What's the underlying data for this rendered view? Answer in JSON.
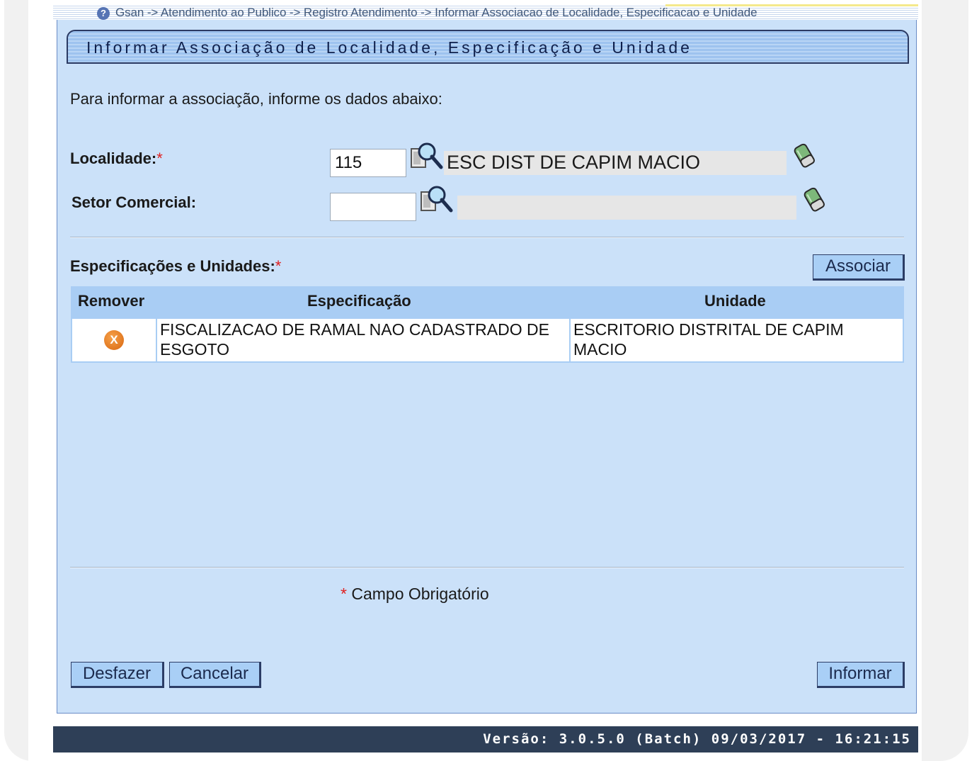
{
  "breadcrumb": {
    "help_icon": "?",
    "text": "Gsan -> Atendimento ao Publico -> Registro Atendimento -> Informar Associacao de Localidade, Especificacao e Unidade"
  },
  "page": {
    "title": "Informar Associação de Localidade, Especificação e Unidade",
    "intro": "Para informar a associação, informe os dados abaixo:"
  },
  "form": {
    "localidade": {
      "label": "Localidade:",
      "required_mark": "*",
      "code": "115",
      "description": "ESC DIST DE CAPIM MACIO",
      "search_icon": "magnifier-search-icon",
      "clear_icon": "eraser-icon"
    },
    "setor_comercial": {
      "label": "Setor Comercial:",
      "code": "",
      "description": "",
      "search_icon": "magnifier-search-icon",
      "clear_icon": "eraser-icon"
    },
    "especificacoes": {
      "label": "Especificações e Unidades:",
      "required_mark": "*",
      "associate_button": "Associar",
      "columns": [
        "Remover",
        "Especificação",
        "Unidade"
      ],
      "rows": [
        {
          "remove_icon": "X",
          "especificacao": "FISCALIZACAO DE RAMAL NAO CADASTRADO DE ESGOTO",
          "unidade": "ESCRITORIO DISTRITAL DE CAPIM MACIO"
        }
      ]
    }
  },
  "footer": {
    "required_mark": "*",
    "required_note": "Campo Obrigatório",
    "buttons": {
      "undo": "Desfazer",
      "cancel": "Cancelar",
      "submit": "Informar"
    },
    "version": "Versão: 3.0.5.0 (Batch) 09/03/2017 - 16:21:15"
  },
  "colors": {
    "panel_bg": "#cbe1f9",
    "table_header_bg": "#a9cdf4",
    "button_bg": "#a9cff6",
    "version_bar_bg": "#2e3f57",
    "required": "#e02020"
  }
}
